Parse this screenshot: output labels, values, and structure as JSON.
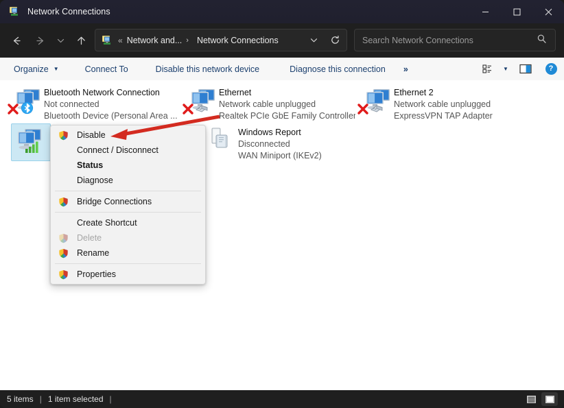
{
  "window": {
    "title": "Network Connections",
    "title_icon": "network-connections-icon",
    "minimize_label": "Minimize",
    "maximize_label": "Maximize",
    "close_label": "Close"
  },
  "nav": {
    "back_label": "Back",
    "forward_label": "Forward",
    "recent_label": "Recent locations",
    "up_label": "Up"
  },
  "address": {
    "icon": "network-connections-icon",
    "overflow": "«",
    "crumb1": "Network and...",
    "separator": "›",
    "crumb2": "Network Connections",
    "dropdown_label": "Previous locations",
    "refresh_label": "Refresh"
  },
  "search": {
    "placeholder": "Search Network Connections",
    "value": "",
    "icon": "search-icon"
  },
  "toolbar": {
    "organize": "Organize",
    "connect_to": "Connect To",
    "disable_device": "Disable this network device",
    "diagnose_connection": "Diagnose this connection",
    "overflow": "»",
    "view_label": "Change your view",
    "preview_pane_label": "Show the preview pane",
    "help_label": "?"
  },
  "connections": [
    {
      "name": "Bluetooth Network Connection",
      "status": "Not connected",
      "device": "Bluetooth Device (Personal Area ...",
      "icon": "network-adapter-icon",
      "overlay": "bluetooth-icon",
      "disabled_badge": true,
      "selected": false
    },
    {
      "name": "Ethernet",
      "status": "Network cable unplugged",
      "device": "Realtek PCIe GbE Family Controller",
      "icon": "network-adapter-icon",
      "overlay": "unplugged-cable-icon",
      "disabled_badge": true,
      "selected": false
    },
    {
      "name": "Ethernet 2",
      "status": "Network cable unplugged",
      "device": "ExpressVPN TAP Adapter",
      "icon": "network-adapter-icon",
      "overlay": "unplugged-cable-icon",
      "disabled_badge": true,
      "selected": false
    },
    {
      "name": "",
      "status": "",
      "device": "",
      "icon": "wifi-adapter-icon",
      "overlay": "signal-bars-icon",
      "disabled_badge": false,
      "selected": true
    },
    {
      "name": "Windows Report",
      "status": "Disconnected",
      "device": "WAN Miniport (IKEv2)",
      "icon": "vpn-connection-icon",
      "overlay": "",
      "disabled_badge": false,
      "selected": false
    }
  ],
  "context_menu": [
    {
      "label": "Disable",
      "icon": "uac-shield-icon",
      "bold": false,
      "disabled": false,
      "separator_after": false
    },
    {
      "label": "Connect / Disconnect",
      "icon": "",
      "bold": false,
      "disabled": false,
      "separator_after": false
    },
    {
      "label": "Status",
      "icon": "",
      "bold": true,
      "disabled": false,
      "separator_after": false
    },
    {
      "label": "Diagnose",
      "icon": "",
      "bold": false,
      "disabled": false,
      "separator_after": true
    },
    {
      "label": "Bridge Connections",
      "icon": "uac-shield-icon",
      "bold": false,
      "disabled": false,
      "separator_after": true
    },
    {
      "label": "Create Shortcut",
      "icon": "",
      "bold": false,
      "disabled": false,
      "separator_after": false
    },
    {
      "label": "Delete",
      "icon": "uac-shield-icon",
      "bold": false,
      "disabled": true,
      "separator_after": false
    },
    {
      "label": "Rename",
      "icon": "uac-shield-icon",
      "bold": false,
      "disabled": false,
      "separator_after": true
    },
    {
      "label": "Properties",
      "icon": "uac-shield-icon",
      "bold": false,
      "disabled": false,
      "separator_after": false
    }
  ],
  "annotation": {
    "type": "red-arrow",
    "color": "#d32b20",
    "points_to": "Disable"
  },
  "statusbar": {
    "item_count": "5 items",
    "sep1": "|",
    "selection": "1 item selected",
    "sep2": "|",
    "details_view_label": "Details view",
    "large_icons_view_label": "Large icons view"
  },
  "colors": {
    "titlebar": "#20202e",
    "chrome_dark": "#1f1f1f",
    "content": "#ffffff",
    "command_bar": "#f7f7f7",
    "command_text": "#1b3f6e",
    "selection": "#cce8f4",
    "accent_blue": "#1f8ad6",
    "annotation_red": "#d32b20"
  }
}
